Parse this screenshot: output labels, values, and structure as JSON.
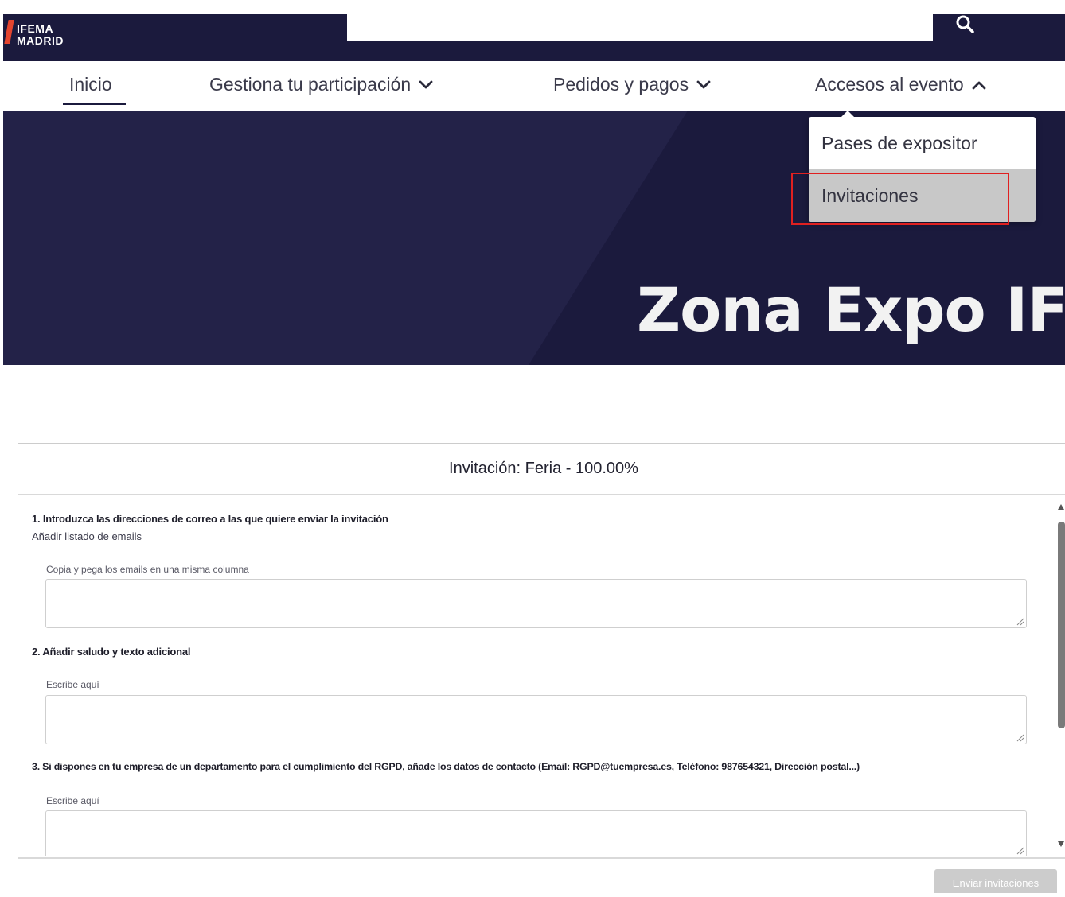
{
  "header": {
    "logo_line1": "IFEMA",
    "logo_line2": "MADRID",
    "search_icon": "search-icon"
  },
  "nav": {
    "items": [
      {
        "label": "Inicio",
        "has_chevron": false,
        "active": true
      },
      {
        "label": "Gestiona tu participación",
        "has_chevron": true,
        "chevron": "chevron-down-icon"
      },
      {
        "label": "Pedidos y pagos",
        "has_chevron": true,
        "chevron": "chevron-down-icon"
      },
      {
        "label": "Accesos al evento",
        "has_chevron": true,
        "chevron": "chevron-up-icon"
      }
    ]
  },
  "dropdown": {
    "items": [
      {
        "label": "Pases de expositor"
      },
      {
        "label": "Invitaciones",
        "highlighted": true
      }
    ]
  },
  "hero": {
    "title": "Zona Expo IFE"
  },
  "form": {
    "title": "Invitación: Feria - 100.00%",
    "q1": {
      "label": "1. Introduzca las direcciones de correo a las que quiere enviar la invitación",
      "sublabel": "Añadir listado de emails",
      "field_label": "Copia y pega los emails en una misma columna",
      "value": ""
    },
    "q2": {
      "label": "2. Añadir saludo y texto adicional",
      "field_label": "Escribe aquí",
      "value": ""
    },
    "q3": {
      "label": "3. Si dispones en tu empresa de un departamento para el cumplimiento del RGPD, añade los datos de contacto (Email: RGPD@tuempresa.es, Teléfono: 987654321, Dirección postal...)",
      "field_label": "Escribe aquí",
      "value": ""
    },
    "submit_label": "Enviar invitaciones"
  },
  "colors": {
    "header_bg": "#1b1a3d",
    "hero_bg": "#2b2a55",
    "logo_accent": "#e4452f",
    "highlight_border": "#e02020",
    "button_disabled_bg": "#cccccc"
  }
}
